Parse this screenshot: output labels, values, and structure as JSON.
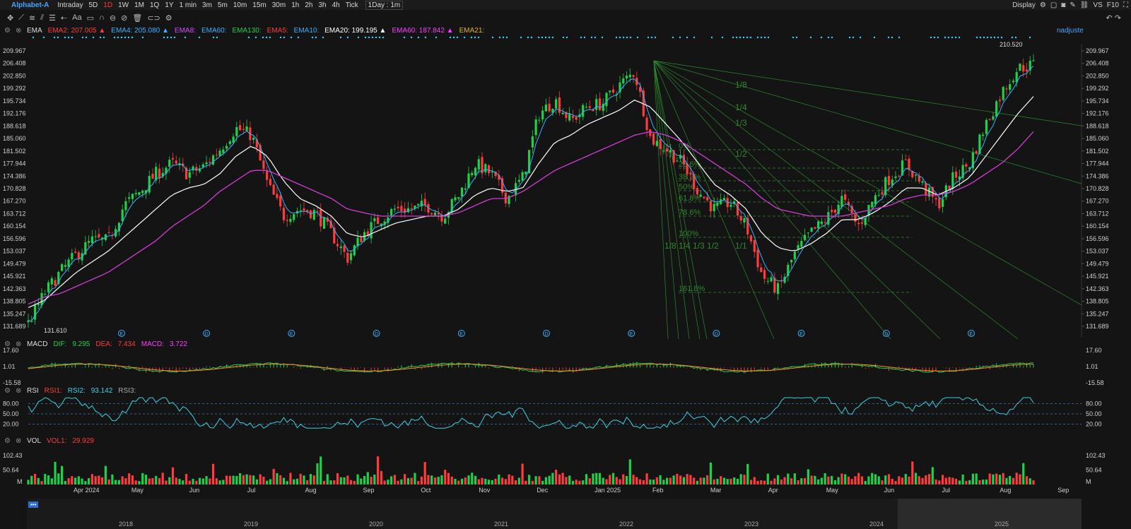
{
  "topbar": {
    "symbol": "Alphabet-A",
    "timeframes": [
      "Intraday",
      "5D",
      "1D",
      "1W",
      "1M",
      "1Q",
      "1Y",
      "1 min",
      "3m",
      "5m",
      "10m",
      "15m",
      "30m",
      "1h",
      "2h",
      "3h",
      "4h",
      "Tick"
    ],
    "active_timeframe": "1D",
    "interval_select": "1Day : 1m",
    "display_label": "Display",
    "right_labels": [
      "VS",
      "F10"
    ]
  },
  "toolbar": {
    "icons": [
      "crosshair-icon",
      "line-icon",
      "multi-line-icon",
      "channel-icon",
      "fib-icon",
      "arrow-icon",
      "text-icon",
      "note-icon",
      "magnet-icon",
      "pattern-icon",
      "lock-icon",
      "hide-icon",
      "trash-icon",
      "link-icon",
      "settings-icon"
    ],
    "text_tool_label": "Aa"
  },
  "ema_header": {
    "name": "EMA",
    "items": [
      {
        "label": "EMA2:",
        "value": "207.005",
        "arrow": "▲",
        "color": "#ff3b3b"
      },
      {
        "label": "EMA4:",
        "value": "205.080",
        "arrow": "▲",
        "color": "#3ab0ff"
      },
      {
        "label": "EMA8:",
        "value": "",
        "arrow": "",
        "color": "#d04bff"
      },
      {
        "label": "EMA60:",
        "value": "",
        "arrow": "",
        "color": "#3ab0ff"
      },
      {
        "label": "EMA130:",
        "value": "",
        "arrow": "",
        "color": "#1fd14a"
      },
      {
        "label": "EMA5:",
        "value": "",
        "arrow": "",
        "color": "#ff3b3b"
      },
      {
        "label": "EMA10:",
        "value": "",
        "arrow": "",
        "color": "#3ab0ff"
      },
      {
        "label": "EMA20:",
        "value": "199.195",
        "arrow": "▲",
        "color": "#ffffff"
      },
      {
        "label": "EMA60:",
        "value": "187.842",
        "arrow": "▲",
        "color": "#ff3bff"
      },
      {
        "label": "EMA21:",
        "value": "",
        "arrow": "",
        "color": "#e6b800"
      }
    ],
    "adjust_label": "nadjuste"
  },
  "macd_header": {
    "name": "MACD",
    "dif_label": "DIF:",
    "dif": "9.295",
    "dea_label": "DEA:",
    "dea": "7.434",
    "macd_label": "MACD:",
    "macd": "3.722"
  },
  "rsi_header": {
    "name": "RSI",
    "rsi1_label": "RSI1:",
    "rsi2_label": "RSI2:",
    "rsi2": "93.142",
    "rsi3_label": "RSI3:"
  },
  "vol_header": {
    "name": "VOL",
    "vol1_label": "VOL1:",
    "vol1": "29.929"
  },
  "chart_data": [
    {
      "type": "candlestick",
      "title": "",
      "y_ticks": [
        "209.967",
        "206.408",
        "202.850",
        "199.292",
        "195.734",
        "192.176",
        "188.618",
        "185.060",
        "181.502",
        "177.944",
        "174.386",
        "170.828",
        "167.270",
        "163.712",
        "160.154",
        "156.596",
        "153.037",
        "149.479",
        "145.921",
        "142.363",
        "138.805",
        "135.247",
        "131.689"
      ],
      "ylim": [
        131.689,
        209.967
      ],
      "x_labels": [
        "Apr 2024",
        "May",
        "Jun",
        "Jul",
        "Aug",
        "Sep",
        "Oct",
        "Nov",
        "Dec",
        "Jan 2025",
        "Feb",
        "Mar",
        "Apr",
        "May",
        "Jun",
        "Jul",
        "Aug",
        "Sep"
      ],
      "annotations": {
        "low": "131.610",
        "high": "210.520"
      },
      "close_path": [
        132.5,
        141,
        147,
        152,
        156,
        156,
        166,
        170,
        175,
        178,
        175,
        177,
        182,
        188,
        186,
        172,
        163,
        165,
        164,
        158,
        151,
        158,
        162,
        165,
        165,
        166,
        163,
        169,
        178,
        175,
        168,
        174,
        192,
        196,
        190,
        194,
        195,
        200,
        204,
        185,
        182,
        178,
        170,
        165,
        167,
        160,
        146,
        142,
        152,
        158,
        162,
        168,
        160,
        168,
        174,
        178,
        172,
        166,
        174,
        178,
        189,
        198,
        205,
        206
      ],
      "ema_white": [
        137,
        139,
        143,
        147,
        150,
        153,
        157,
        161,
        165,
        169,
        171,
        172,
        175,
        180,
        183,
        180,
        173,
        168,
        166,
        163,
        158,
        157,
        159,
        161,
        162,
        163,
        163,
        165,
        169,
        171,
        170,
        171,
        178,
        184,
        186,
        189,
        191,
        193,
        196,
        194,
        189,
        184,
        178,
        172,
        169,
        165,
        158,
        154,
        153,
        155,
        158,
        162,
        162,
        164,
        167,
        171,
        171,
        169,
        171,
        174,
        180,
        186,
        192,
        197
      ],
      "ema_magenta": [
        138,
        140,
        141,
        143,
        145,
        147,
        150,
        153,
        156,
        160,
        163,
        166,
        170,
        173,
        176,
        176,
        174,
        172,
        170,
        168,
        165,
        164,
        163,
        163,
        163,
        163,
        163,
        164,
        166,
        168,
        168,
        170,
        173,
        176,
        178,
        180,
        182,
        184,
        186,
        187,
        186,
        184,
        181,
        178,
        175,
        172,
        168,
        165,
        164,
        163,
        163,
        163,
        164,
        165,
        166,
        168,
        169,
        169,
        170,
        172,
        175,
        178,
        182,
        187
      ],
      "fib_levels": [
        "0%",
        "23.6%",
        "38.2%",
        "50%",
        "61.8%",
        "78.6%",
        "100%",
        "161.8%"
      ],
      "fan_labels": [
        "1/8",
        "1/4",
        "1/3",
        "1/2",
        "1/1",
        "1/8 1/4 1/3 1/2"
      ],
      "event_markers": [
        "E",
        "D",
        "E",
        "D",
        "E",
        "D",
        "E",
        "D",
        "E",
        "D",
        "E"
      ]
    },
    {
      "type": "line",
      "title": "",
      "y_ticks": [
        "17.60",
        "1.01",
        "-15.58"
      ],
      "ylim": [
        -15.58,
        17.6
      ]
    },
    {
      "type": "line",
      "title": "",
      "y_ticks": [
        "80.00",
        "50.00",
        "20.00"
      ],
      "ylim": [
        0,
        100
      ]
    },
    {
      "type": "bar",
      "title": "",
      "y_ticks": [
        "102.43",
        "50.64",
        "M"
      ],
      "ylim": [
        0,
        120
      ]
    }
  ],
  "scroller": {
    "years": [
      "2018",
      "2019",
      "2020",
      "2021",
      "2022",
      "2023",
      "2024",
      "2025"
    ],
    "button": "•••"
  },
  "colors": {
    "up": "#1fd14a",
    "down": "#ff3b3b",
    "ema_cyan": "#3ab0ff",
    "ema_white": "#ffffff",
    "ema_magenta": "#d43bd4",
    "fib": "#2c8a2c"
  }
}
